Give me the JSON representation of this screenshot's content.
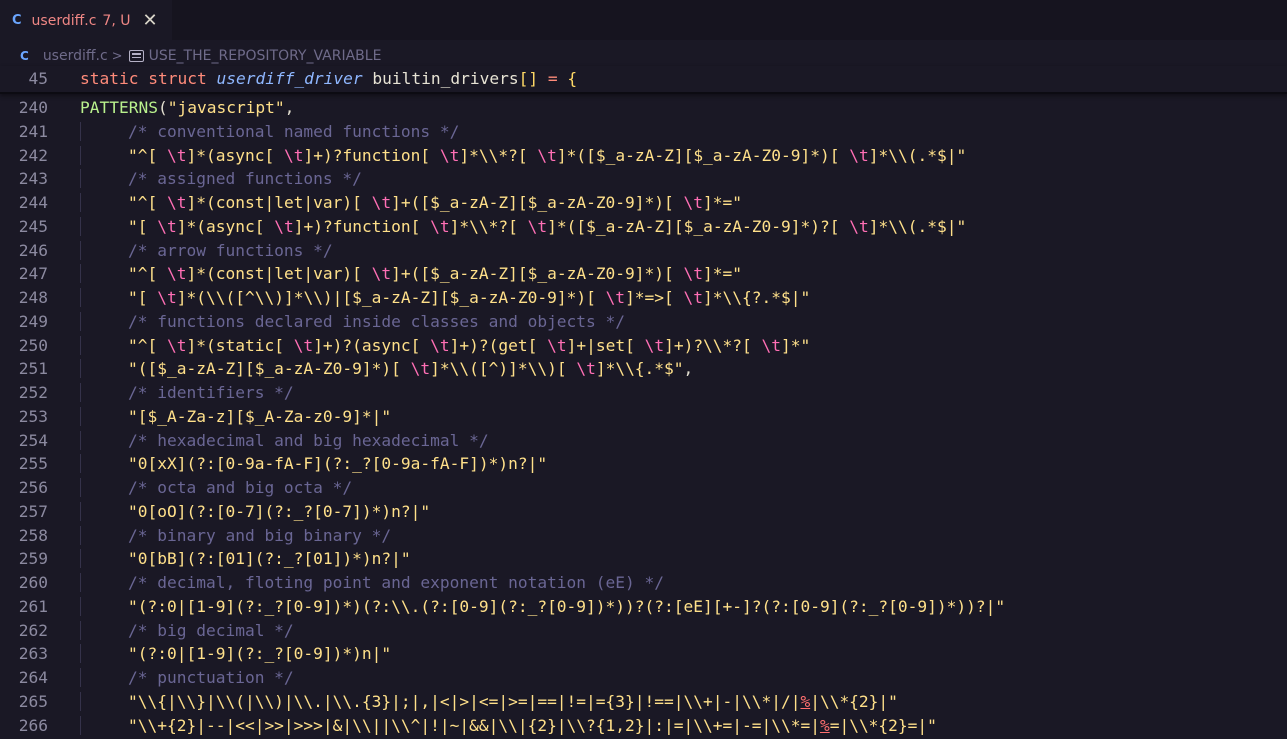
{
  "tab": {
    "language_icon": "C",
    "filename": "userdiff.c",
    "status": "7, U",
    "close_glyph": "✕"
  },
  "breadcrumb": {
    "language_icon": "C",
    "file": "userdiff.c",
    "separator": ">",
    "symbol_icon": "symbol-constant-icon",
    "symbol": "USE_THE_REPOSITORY_VARIABLE"
  },
  "sticky_line": {
    "number": "45",
    "kw1": "static",
    "kw2": "struct",
    "type": "userdiff_driver",
    "ident": "builtin_drivers",
    "brackets": "[]",
    "assign": "=",
    "brace": "{"
  },
  "lines": [
    {
      "n": "240",
      "fn": "PATTERNS",
      "open": "(",
      "str": "\"javascript\"",
      "tail": ","
    },
    {
      "n": "241",
      "comment": "/* conventional named functions */"
    },
    {
      "n": "242",
      "str": "\"^[ \\t]*(async[ \\t]+)?function[ \\t]*\\\\*?[ \\t]*([$_a-zA-Z][$_a-zA-Z0-9]*)[ \\t]*\\\\(.*$|\""
    },
    {
      "n": "243",
      "comment": "/* assigned functions */"
    },
    {
      "n": "244",
      "str": "\"^[ \\t]*(const|let|var)[ \\t]+([$_a-zA-Z][$_a-zA-Z0-9]*)[ \\t]*=\""
    },
    {
      "n": "245",
      "str": "\"[ \\t]*(async[ \\t]+)?function[ \\t]*\\\\*?[ \\t]*([$_a-zA-Z][$_a-zA-Z0-9]*)?[ \\t]*\\\\(.*$|\""
    },
    {
      "n": "246",
      "comment": "/* arrow functions */"
    },
    {
      "n": "247",
      "str": "\"^[ \\t]*(const|let|var)[ \\t]+([$_a-zA-Z][$_a-zA-Z0-9]*)[ \\t]*=\""
    },
    {
      "n": "248",
      "str": "\"[ \\t]*(\\\\([^\\\\)]*\\\\)|[$_a-zA-Z][$_a-zA-Z0-9]*)[ \\t]*=>[ \\t]*\\\\{?.*$|\""
    },
    {
      "n": "249",
      "comment": "/* functions declared inside classes and objects */"
    },
    {
      "n": "250",
      "str": "\"^[ \\t]*(static[ \\t]+)?(async[ \\t]+)?(get[ \\t]+|set[ \\t]+)?\\\\*?[ \\t]*\""
    },
    {
      "n": "251",
      "str": "\"([$_a-zA-Z][$_a-zA-Z0-9]*)[ \\t]*\\\\([^)]*\\\\)[ \\t]*\\\\{.*$\"",
      "tail": ","
    },
    {
      "n": "252",
      "comment": "/* identifiers */"
    },
    {
      "n": "253",
      "str": "\"[$_A-Za-z][$_A-Za-z0-9]*|\""
    },
    {
      "n": "254",
      "comment": "/* hexadecimal and big hexadecimal */"
    },
    {
      "n": "255",
      "str": "\"0[xX](?:[0-9a-fA-F](?:_?[0-9a-fA-F])*)n?|\""
    },
    {
      "n": "256",
      "comment": "/* octa and big octa */"
    },
    {
      "n": "257",
      "str": "\"0[oO](?:[0-7](?:_?[0-7])*)n?|\""
    },
    {
      "n": "258",
      "comment": "/* binary and big binary */"
    },
    {
      "n": "259",
      "str": "\"0[bB](?:[01](?:_?[01])*)n?|\""
    },
    {
      "n": "260",
      "comment": "/* decimal, floting point and exponent notation (eE) */"
    },
    {
      "n": "261",
      "str": "\"(?:0|[1-9](?:_?[0-9])*)(?:\\\\.(?:[0-9](?:_?[0-9])*))?(?:[eE][+-]?(?:[0-9](?:_?[0-9])*))?|\""
    },
    {
      "n": "262",
      "comment": "/* big decimal */"
    },
    {
      "n": "263",
      "str": "\"(?:0|[1-9](?:_?[0-9])*)n|\""
    },
    {
      "n": "264",
      "comment": "/* punctuation */"
    },
    {
      "n": "265",
      "str": "\"\\\\{|\\\\}|\\\\(|\\\\)|\\\\.|\\\\.{3}|;|,|<|>|<=|>=|==|!=|={3}|!==|\\\\+|-|\\\\*|/|%|\\\\*{2}|\""
    },
    {
      "n": "266",
      "str": "\"\\\\+{2}|--|<<|>>|>>>|&|\\\\||\\\\^|!|~|&&|\\\\|{2}|\\\\?{1,2}|:|=|\\\\+=|-=|\\\\*=|%=|\\\\*{2}=|\""
    }
  ]
}
